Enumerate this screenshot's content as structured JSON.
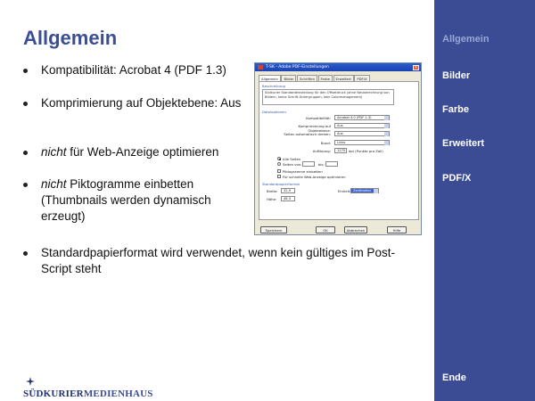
{
  "slide": {
    "title": "Allgemein",
    "bullets": [
      {
        "text": "Kompatibilität: Acrobat 4 (PDF 1.3)"
      },
      {
        "text": "Komprimierung auf Objektebene: Aus"
      },
      {
        "emph": "nicht",
        "rest": " für Web-Anzeige optimieren"
      },
      {
        "emph": "nicht",
        "rest": " Piktogramme einbetten (Thumbnails werden dynamisch erzeugt)"
      },
      {
        "text": "Standardpapierformat wird verwendet, wenn kein gültiges im Post-Script steht"
      }
    ]
  },
  "sidebar": {
    "items": [
      {
        "label": "Allgemein",
        "active": true
      },
      {
        "label": "Bilder"
      },
      {
        "label": "Farbe"
      },
      {
        "label": "Erweitert"
      },
      {
        "label": "PDF/X"
      }
    ],
    "end_label": "Ende",
    "bg_color": "#3b4c95",
    "active_color": "#9aa6d6"
  },
  "logo": {
    "part1": "SÜDKURIER",
    "part2": "MEDIENHAUS"
  },
  "dialog": {
    "title": "T-SK - Adobe PDF-Einstellungen",
    "tabs": [
      "Allgemein",
      "Bilder",
      "Schriften",
      "Farbe",
      "Erweitert",
      "PDF/X"
    ],
    "description_label": "Beschreibung",
    "description_text": "Südkurier Standardeinstellung für den Offsetdruck (ohne Neuberechnung von Bildern, keine Schrift-Untergruppen, kein Colormanagement)",
    "file_options_label": "Dateioptionen",
    "compat_label": "Kompatibilität:",
    "compat_value": "Acrobat 4.0 (PDF 1.3)",
    "compression_label": "Komprimierung auf Objektebene:",
    "compression_value": "Aus",
    "rotate_label": "Seiten automatisch drehen:",
    "rotate_value": "Aus",
    "binding_label": "Bund:",
    "binding_value": "Links",
    "resolution_label": "Auflösung:",
    "resolution_value": "1270",
    "resolution_unit": "dpi (Punkte pro Zoll)",
    "all_pages_label": "Alle Seiten",
    "pages_from_label": "Seiten von:",
    "pages_to_label": "bis:",
    "thumbnails_label": "Piktogramme einbetten",
    "web_optimize_label": "Für schnelle Web-Anzeige optimieren",
    "paper_label": "Standardpapierformat",
    "width_label": "Breite:",
    "width_value": "32,9",
    "unit_label": "Einheit:",
    "unit_value": "Zentimeter",
    "height_label": "Höhe:",
    "height_value": "48,3",
    "save_button": "Speichern unter...",
    "ok_button": "OK",
    "cancel_button": "Abbrechen",
    "help_button": "Hilfe"
  }
}
